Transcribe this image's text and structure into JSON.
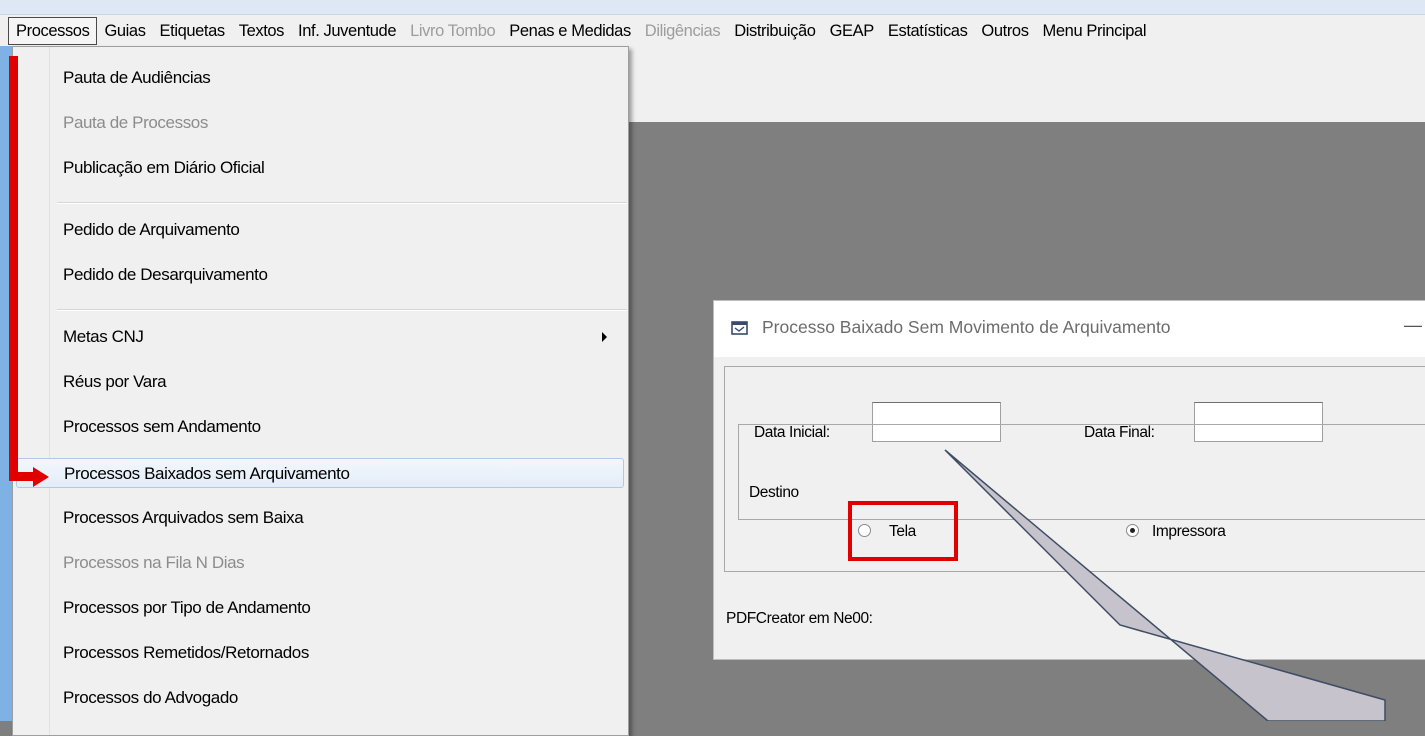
{
  "menubar": {
    "items": [
      {
        "label": "Processos",
        "state": "active"
      },
      {
        "label": "Guias",
        "state": "enabled"
      },
      {
        "label": "Etiquetas",
        "state": "enabled"
      },
      {
        "label": "Textos",
        "state": "enabled"
      },
      {
        "label": "Inf. Juventude",
        "state": "enabled"
      },
      {
        "label": "Livro Tombo",
        "state": "disabled"
      },
      {
        "label": "Penas e Medidas",
        "state": "enabled"
      },
      {
        "label": "Diligências",
        "state": "disabled"
      },
      {
        "label": "Distribuição",
        "state": "enabled"
      },
      {
        "label": "GEAP",
        "state": "enabled"
      },
      {
        "label": "Estatísticas",
        "state": "enabled"
      },
      {
        "label": "Outros",
        "state": "enabled"
      },
      {
        "label": "Menu Principal",
        "state": "enabled"
      }
    ]
  },
  "dropdown": {
    "items": [
      {
        "label": "Pauta de Audiências"
      },
      {
        "label": "Pauta de Processos",
        "disabled": true
      },
      {
        "label": "Publicação em Diário Oficial"
      },
      {
        "label": "Pedido de Arquivamento"
      },
      {
        "label": "Pedido de Desarquivamento"
      },
      {
        "label": "Metas CNJ",
        "submenu": true
      },
      {
        "label": "Réus por Vara"
      },
      {
        "label": "Processos sem Andamento"
      },
      {
        "label": "Processos Baixados sem Arquivamento",
        "highlighted": true
      },
      {
        "label": "Processos Arquivados sem Baixa"
      },
      {
        "label": "Processos na Fila N Dias",
        "disabled": true
      },
      {
        "label": "Processos por Tipo de Andamento"
      },
      {
        "label": "Processos Remetidos/Retornados"
      },
      {
        "label": "Processos do Advogado"
      }
    ]
  },
  "dialog": {
    "title": "Processo Baixado Sem Movimento de Arquivamento",
    "minimize_glyph": "—",
    "data_inicial_label": "Data Inicial:",
    "data_inicial_value": "",
    "data_final_label": "Data Final:",
    "data_final_value": "",
    "destino_label": "Destino",
    "tela_label": "Tela",
    "impressora_label": "Impressora",
    "selected_destino": "Impressora",
    "printer_text": "PDFCreator em Ne00:"
  },
  "annotations": {
    "arrow_color": "#e00000",
    "highlight_box_color": "#e00000",
    "callout_fill": "#c6c3cc"
  }
}
